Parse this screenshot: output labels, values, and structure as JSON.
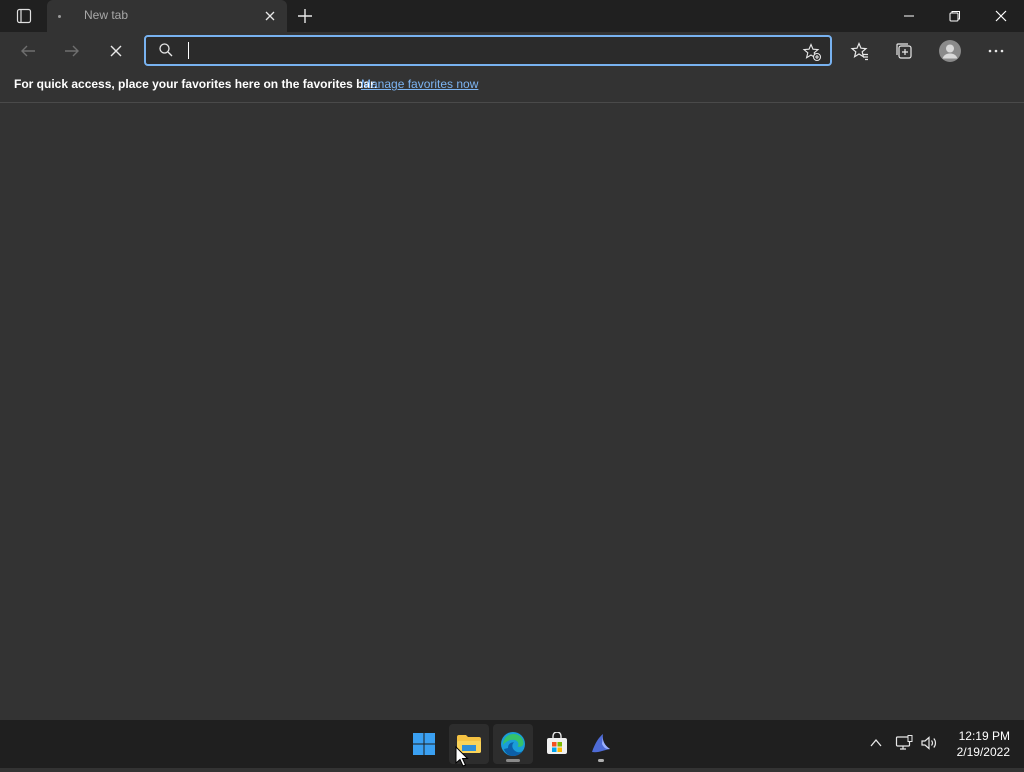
{
  "browser": {
    "tab": {
      "title": "New tab"
    },
    "address_bar": {
      "value": "",
      "placeholder": ""
    },
    "favorites_bar": {
      "message": "For quick access, place your favorites here on the favorites bar.",
      "link": "Manage favorites now"
    }
  },
  "taskbar": {
    "apps": [
      "windows-start",
      "file-explorer",
      "microsoft-edge",
      "microsoft-store",
      "app-shell"
    ],
    "clock": {
      "time": "12:19 PM",
      "date": "2/19/2022"
    }
  },
  "colors": {
    "accent": "#78b2f0",
    "link": "#7cb4f2",
    "page_bg": "#333333",
    "titlebar_bg": "#202020",
    "taskbar_bg": "#1f1f1f"
  }
}
